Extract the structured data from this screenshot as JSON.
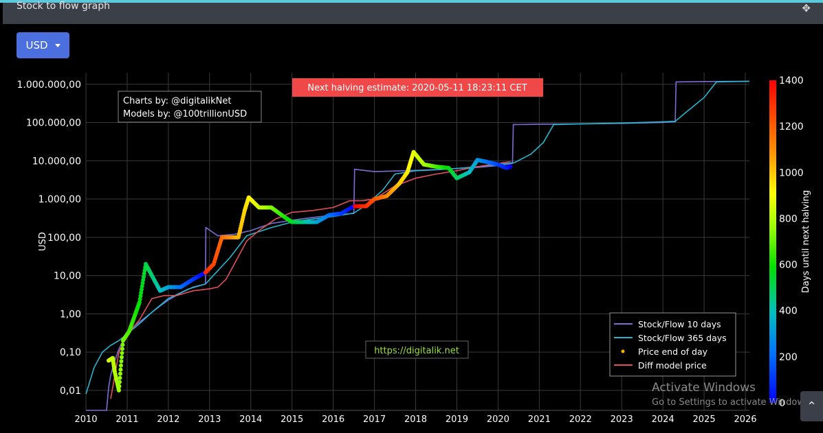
{
  "panel": {
    "title": "Stock to flow graph",
    "move_icon": "move-arrows-icon"
  },
  "currency": {
    "label": "USD"
  },
  "watermark": {
    "line1": "Activate Windows",
    "line2": "Go to Settings to activate Windows."
  },
  "scroll_icon": "chevron-up-icon",
  "chart_data": {
    "type": "line",
    "ylabel": "USD",
    "yscale": "log",
    "ylim": [
      0.003,
      2000000
    ],
    "xlim": [
      2010,
      2026.1
    ],
    "x_ticks": [
      "2010",
      "2011",
      "2012",
      "2013",
      "2014",
      "2015",
      "2016",
      "2017",
      "2018",
      "2019",
      "2020",
      "2021",
      "2022",
      "2023",
      "2024",
      "2025",
      "2026"
    ],
    "y_ticks": [
      {
        "v": 0.01,
        "label": "0,01"
      },
      {
        "v": 0.1,
        "label": "0,10"
      },
      {
        "v": 1,
        "label": "1,00"
      },
      {
        "v": 10,
        "label": "10,00"
      },
      {
        "v": 100,
        "label": "100,00"
      },
      {
        "v": 1000,
        "label": "1.000,00"
      },
      {
        "v": 10000,
        "label": "10.000,00"
      },
      {
        "v": 100000,
        "label": "100.000,00"
      },
      {
        "v": 1000000,
        "label": "1.000.000,00"
      }
    ],
    "annotations": {
      "halving": "Next halving estimate: 2020-05-11 18:23:11 CET",
      "credits_line1": "Charts by: @digitalikNet",
      "credits_line2": "Models by: @100trillionUSD",
      "url": "https://digitalik.net"
    },
    "colorbar": {
      "title": "Days until next halving",
      "ticks": [
        "0",
        "200",
        "400",
        "600",
        "800",
        "1000",
        "1200",
        "1400"
      ]
    },
    "legend": {
      "placement": "bottom-right",
      "items": [
        {
          "name": "Stock/Flow 10 days",
          "color": "#7b6fd6",
          "kind": "line"
        },
        {
          "name": "Stock/Flow 365 days",
          "color": "#27b6d0",
          "kind": "line"
        },
        {
          "name": "Price end of day",
          "color": "#ffb000",
          "kind": "dot"
        },
        {
          "name": "Diff model price",
          "color": "#e0505a",
          "kind": "line"
        }
      ]
    },
    "series": [
      {
        "name": "Stock/Flow 10 days",
        "color": "#7b6fd6",
        "points": [
          [
            2010.0,
            0.003
          ],
          [
            2010.5,
            0.003
          ],
          [
            2010.55,
            0.012
          ],
          [
            2010.6,
            0.025
          ],
          [
            2010.7,
            0.06
          ],
          [
            2010.8,
            0.12
          ],
          [
            2010.9,
            0.2
          ],
          [
            2011.0,
            0.3
          ],
          [
            2011.2,
            0.5
          ],
          [
            2011.5,
            0.9
          ],
          [
            2011.8,
            1.6
          ],
          [
            2012.0,
            2.3
          ],
          [
            2012.3,
            3.5
          ],
          [
            2012.6,
            5
          ],
          [
            2012.9,
            6
          ],
          [
            2012.91,
            180
          ],
          [
            2013.2,
            110
          ],
          [
            2013.6,
            120
          ],
          [
            2014.0,
            150
          ],
          [
            2014.5,
            230
          ],
          [
            2015.0,
            280
          ],
          [
            2015.5,
            330
          ],
          [
            2016.0,
            380
          ],
          [
            2016.5,
            420
          ],
          [
            2016.52,
            6000
          ],
          [
            2017.0,
            5200
          ],
          [
            2017.5,
            5400
          ],
          [
            2018.0,
            5600
          ],
          [
            2018.5,
            5900
          ],
          [
            2019.0,
            6300
          ],
          [
            2019.5,
            6700
          ],
          [
            2020.0,
            7500
          ],
          [
            2020.35,
            8500
          ],
          [
            2020.37,
            88000
          ],
          [
            2021.0,
            90000
          ],
          [
            2022.0,
            92000
          ],
          [
            2023.0,
            95000
          ],
          [
            2024.0,
            100000
          ],
          [
            2024.3,
            105000
          ],
          [
            2024.32,
            1150000
          ],
          [
            2025.0,
            1180000
          ],
          [
            2026.1,
            1200000
          ]
        ]
      },
      {
        "name": "Stock/Flow 365 days",
        "color": "#27b6d0",
        "points": [
          [
            2010.0,
            0.008
          ],
          [
            2010.2,
            0.04
          ],
          [
            2010.4,
            0.1
          ],
          [
            2010.6,
            0.15
          ],
          [
            2010.8,
            0.2
          ],
          [
            2011.0,
            0.3
          ],
          [
            2011.3,
            0.55
          ],
          [
            2011.6,
            1.1
          ],
          [
            2012.0,
            2.5
          ],
          [
            2012.5,
            4.5
          ],
          [
            2012.9,
            6
          ],
          [
            2013.5,
            30
          ],
          [
            2013.9,
            110
          ],
          [
            2014.5,
            180
          ],
          [
            2015.0,
            250
          ],
          [
            2015.5,
            300
          ],
          [
            2016.0,
            350
          ],
          [
            2016.5,
            430
          ],
          [
            2016.8,
            700
          ],
          [
            2017.2,
            1700
          ],
          [
            2017.5,
            4500
          ],
          [
            2018.0,
            5500
          ],
          [
            2018.5,
            5800
          ],
          [
            2019.0,
            6300
          ],
          [
            2019.5,
            7000
          ],
          [
            2020.0,
            8000
          ],
          [
            2020.4,
            9000
          ],
          [
            2020.8,
            15000
          ],
          [
            2021.1,
            30000
          ],
          [
            2021.35,
            88000
          ],
          [
            2022.0,
            92000
          ],
          [
            2023.0,
            97000
          ],
          [
            2024.0,
            104000
          ],
          [
            2024.3,
            108000
          ],
          [
            2024.6,
            200000
          ],
          [
            2025.0,
            450000
          ],
          [
            2025.3,
            1150000
          ],
          [
            2026.1,
            1200000
          ]
        ]
      },
      {
        "name": "Diff model price",
        "color": "#e0505a",
        "points": [
          [
            2010.6,
            0.006
          ],
          [
            2010.8,
            0.1
          ],
          [
            2011.0,
            0.28
          ],
          [
            2011.3,
            0.7
          ],
          [
            2011.6,
            2.5
          ],
          [
            2011.9,
            3
          ],
          [
            2012.2,
            3
          ],
          [
            2012.6,
            4
          ],
          [
            2013.0,
            4.5
          ],
          [
            2013.2,
            5
          ],
          [
            2013.4,
            8
          ],
          [
            2013.6,
            20
          ],
          [
            2013.9,
            80
          ],
          [
            2014.2,
            150
          ],
          [
            2014.6,
            300
          ],
          [
            2015.0,
            450
          ],
          [
            2015.5,
            500
          ],
          [
            2016.0,
            600
          ],
          [
            2016.4,
            900
          ],
          [
            2016.7,
            900
          ],
          [
            2017.0,
            1000
          ],
          [
            2017.5,
            2200
          ],
          [
            2018.0,
            3500
          ],
          [
            2018.5,
            4500
          ],
          [
            2019.0,
            5500
          ],
          [
            2019.5,
            7000
          ],
          [
            2020.0,
            8500
          ],
          [
            2020.3,
            9500
          ]
        ]
      },
      {
        "name": "Price end of day",
        "color": "#ffb000",
        "points": [
          [
            2010.55,
            0.06
          ],
          [
            2010.65,
            0.07
          ],
          [
            2010.7,
            0.03
          ],
          [
            2010.8,
            0.01
          ],
          [
            2010.9,
            0.2
          ],
          [
            2011.05,
            0.35
          ],
          [
            2011.2,
            1
          ],
          [
            2011.3,
            2
          ],
          [
            2011.45,
            20
          ],
          [
            2011.6,
            10
          ],
          [
            2011.8,
            4
          ],
          [
            2012.0,
            5
          ],
          [
            2012.3,
            5
          ],
          [
            2012.6,
            8
          ],
          [
            2012.9,
            12
          ],
          [
            2013.1,
            20
          ],
          [
            2013.3,
            100
          ],
          [
            2013.5,
            100
          ],
          [
            2013.7,
            100
          ],
          [
            2013.85,
            500
          ],
          [
            2013.95,
            1100
          ],
          [
            2014.2,
            600
          ],
          [
            2014.5,
            600
          ],
          [
            2014.8,
            350
          ],
          [
            2015.0,
            250
          ],
          [
            2015.3,
            250
          ],
          [
            2015.6,
            250
          ],
          [
            2015.9,
            380
          ],
          [
            2016.2,
            420
          ],
          [
            2016.5,
            650
          ],
          [
            2016.8,
            650
          ],
          [
            2017.0,
            1000
          ],
          [
            2017.3,
            1200
          ],
          [
            2017.6,
            2500
          ],
          [
            2017.8,
            5000
          ],
          [
            2017.95,
            17000
          ],
          [
            2018.2,
            8000
          ],
          [
            2018.5,
            7000
          ],
          [
            2018.8,
            6500
          ],
          [
            2019.0,
            3500
          ],
          [
            2019.3,
            5000
          ],
          [
            2019.5,
            10500
          ],
          [
            2019.7,
            9500
          ],
          [
            2020.0,
            8000
          ],
          [
            2020.2,
            6500
          ],
          [
            2020.3,
            7000
          ]
        ]
      }
    ]
  }
}
